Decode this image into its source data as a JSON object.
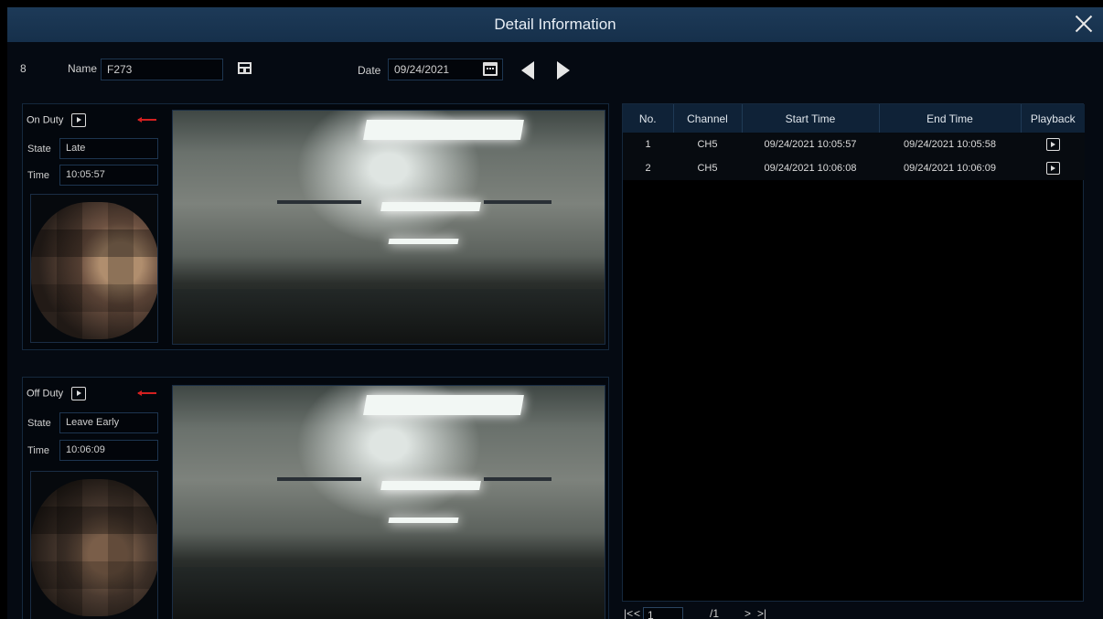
{
  "window": {
    "title": "Detail Information"
  },
  "header": {
    "index": "8",
    "name_label": "Name",
    "name_value": "F273",
    "date_label": "Date",
    "date_value": "09/24/2021"
  },
  "on_duty": {
    "title": "On Duty",
    "state_label": "State",
    "state_value": "Late",
    "time_label": "Time",
    "time_value": "10:05:57"
  },
  "off_duty": {
    "title": "Off Duty",
    "state_label": "State",
    "state_value": "Leave Early",
    "time_label": "Time",
    "time_value": "10:06:09"
  },
  "table": {
    "headers": [
      "No.",
      "Channel",
      "Start Time",
      "End Time",
      "Playback"
    ],
    "rows": [
      {
        "no": "1",
        "channel": "CH5",
        "start": "09/24/2021 10:05:57",
        "end": "09/24/2021 10:05:58",
        "playback_icon": "play-icon"
      },
      {
        "no": "2",
        "channel": "CH5",
        "start": "09/24/2021 10:06:08",
        "end": "09/24/2021 10:06:09",
        "playback_icon": "play-icon"
      }
    ]
  },
  "pager": {
    "first": "|<",
    "prev": "<",
    "current": "1",
    "total": "/1",
    "next": ">",
    "last": ">|"
  },
  "colors": {
    "title_bar": "#1d3a58",
    "table_header": "#0f2237",
    "arrow_red": "#d42020"
  },
  "icons": [
    "close-icon",
    "record-icon",
    "calendar-icon",
    "prev-arrow-icon",
    "next-arrow-icon",
    "play-icon"
  ]
}
